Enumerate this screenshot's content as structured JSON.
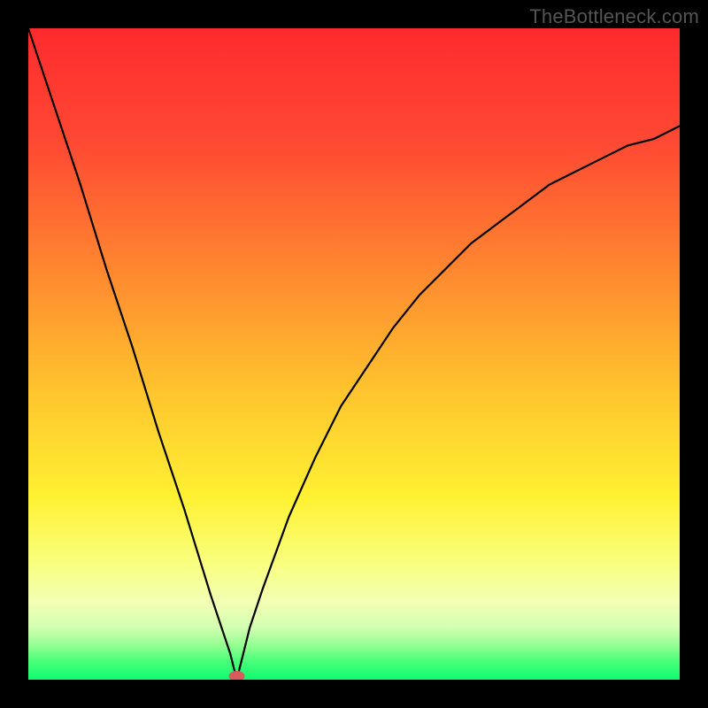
{
  "watermark": {
    "text": "TheBottleneck.com"
  },
  "chart_data": {
    "type": "line",
    "title": "",
    "xlabel": "",
    "ylabel": "",
    "xlim": [
      0,
      100
    ],
    "ylim": [
      0,
      100
    ],
    "optimum_x": 32,
    "series": [
      {
        "name": "bottleneck-curve",
        "x": [
          0,
          4,
          8,
          12,
          16,
          20,
          24,
          28,
          30,
          31,
          32,
          33,
          34,
          36,
          40,
          44,
          48,
          52,
          56,
          60,
          64,
          68,
          72,
          76,
          80,
          84,
          88,
          92,
          96,
          100
        ],
        "values": [
          100,
          88,
          76,
          63,
          51,
          38,
          26,
          13,
          7,
          4,
          0,
          4,
          8,
          14,
          25,
          34,
          42,
          48,
          54,
          59,
          63,
          67,
          70,
          73,
          76,
          78,
          80,
          82,
          83,
          85
        ]
      }
    ],
    "marker": {
      "x": 32,
      "y": 0,
      "color": "#d95b5b"
    },
    "gradient_stops": [
      {
        "offset": "0%",
        "color": "#ff2a2e"
      },
      {
        "offset": "18%",
        "color": "#ff4a33"
      },
      {
        "offset": "38%",
        "color": "#ff8a2f"
      },
      {
        "offset": "55%",
        "color": "#ffc22e"
      },
      {
        "offset": "72%",
        "color": "#fff132"
      },
      {
        "offset": "82%",
        "color": "#f9ff7d"
      },
      {
        "offset": "88%",
        "color": "#f3ffb4"
      },
      {
        "offset": "92%",
        "color": "#d3ffb0"
      },
      {
        "offset": "95%",
        "color": "#8dff90"
      },
      {
        "offset": "97%",
        "color": "#4dff7a"
      },
      {
        "offset": "100%",
        "color": "#0efc70"
      }
    ]
  }
}
